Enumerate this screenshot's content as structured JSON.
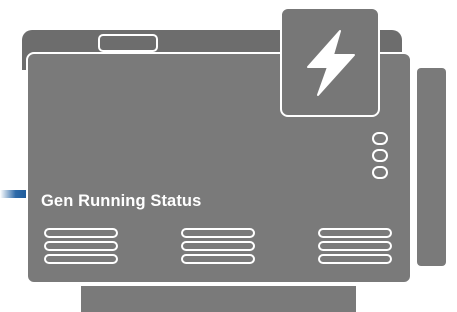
{
  "status": {
    "label": "Gen Running Status"
  },
  "icons": {
    "power": "lightning-bolt-icon"
  },
  "colors": {
    "housing": "#7a7a7a",
    "outline": "#ffffff",
    "pipe": "#1f5c9b"
  }
}
